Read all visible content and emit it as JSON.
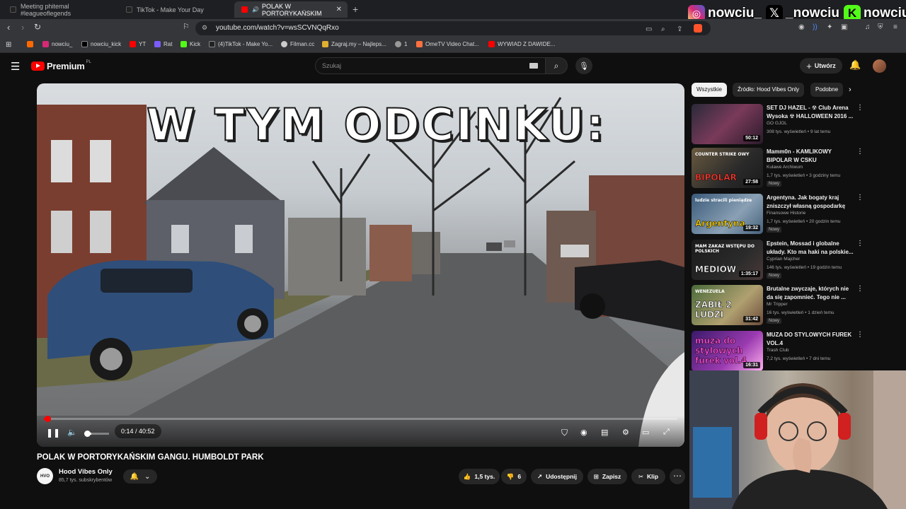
{
  "browser": {
    "tabs": [
      {
        "label": "Meeting phitemal #leagueoflegends",
        "active": false
      },
      {
        "label": "TikTok - Make Your Day",
        "active": false
      },
      {
        "label": "POLAK W PORTORYKAŃSKIM",
        "active": true
      }
    ],
    "url": "youtube.com/watch?v=wsSCVNQqRxo",
    "bookmarks": [
      "nowciu_",
      "nowciu_kick",
      "YT",
      "Rat",
      "Kick",
      "(4)TikTok - Make Yo...",
      "Filman.cc",
      "Zagraj.my – Najleps...",
      "1",
      "OmeTV Video Chat...",
      "WYWIAD Z DAWIDE..."
    ]
  },
  "social_overlay": {
    "instagram": "nowciu_",
    "x": "_nowciu",
    "kick": "nowciu"
  },
  "youtube": {
    "logo_text": "Premium",
    "logo_country": "PL",
    "search_placeholder": "Szukaj",
    "create_label": "Utwórz"
  },
  "player": {
    "overlay_caption": "W TYM ODCINKU:",
    "current_time": "0:14",
    "duration": "40:52",
    "time_display": "0:14 / 40:52",
    "progress_fraction": 0.0057,
    "volume_fraction": 0.25,
    "state": "playing"
  },
  "video": {
    "title": "POLAK W PORTORYKAŃSKIM GANGU. HUMBOLDT PARK",
    "channel": "Hood Vibes Only",
    "subscribers": "85,7 tys. subskrybentów",
    "likes": "1,5 tys.",
    "dislikes": "6",
    "share_label": "Udostępnij",
    "save_label": "Zapisz",
    "clip_label": "Klip"
  },
  "sidebar": {
    "chips": [
      "Wszystkie",
      "Źródło: Hood Vibes Only",
      "Podobne"
    ],
    "recommendations": [
      {
        "title": "SET DJ HAZEL - ☢ Club Arena Wysoka ☢ HALLOWEEN 2016 ...",
        "channel": "GO GJOL",
        "meta": "308 tys. wyświetleń • 9 lat temu",
        "duration": "50:12",
        "new": "",
        "thumb_text": "",
        "accent": "#7a3a5a"
      },
      {
        "title": "Mamm0n - KAMLIKOWY BIPOLAR W CSKU",
        "channel": "Kulawe Archiwum",
        "meta": "1,7 tys. wyświetleń • 3 godziny temu",
        "duration": "27:58",
        "new": "Nowy",
        "thumb_text": "BIPOLAR",
        "thumb_text2": "COUNTER STRIKE OWY",
        "accent": "#ff3b2f"
      },
      {
        "title": "Argentyna. Jak bogaty kraj zniszczył własną gospodarkę",
        "channel": "Finansowe Historie",
        "meta": "1,7 tys. wyświetleń • 20 godzin temu",
        "duration": "19:32",
        "new": "Nowy",
        "thumb_text": "Argentyna",
        "thumb_text2": "ludzie stracili pieniądze",
        "accent": "#ffd400"
      },
      {
        "title": "Epstein, Mossad i globalne układy. Kto ma haki na polskie...",
        "channel": "Cyprian Majcher",
        "meta": "146 tys. wyświetleń • 19 godzin temu",
        "duration": "1:35:17",
        "new": "Nowy",
        "thumb_text": "MEDIÓW",
        "thumb_text2": "MAM ZAKAZ WSTĘPU DO POLSKICH",
        "accent": "#ffffff"
      },
      {
        "title": "Brutalne zwyczaje, których nie da się zapomnieć. Tego nie ...",
        "channel": "Mr Tripper",
        "meta": "16 tys. wyświetleń • 1 dzień temu",
        "duration": "31:42",
        "new": "Nowy",
        "thumb_text": "ZABIŁ 2 LUDZI",
        "thumb_text2": "WENEZUELA",
        "accent": "#ffffff"
      },
      {
        "title": "MUZA DO STYLOWYCH FUREK VOL.4",
        "channel": "Trash Club",
        "meta": "7,2 tys. wyświetleń • 7 dni temu",
        "duration": "16:31",
        "new": "",
        "thumb_text": "muza do stylowych furek vol.4",
        "thumb_text2": "",
        "accent": "#ff4fd8"
      }
    ]
  }
}
